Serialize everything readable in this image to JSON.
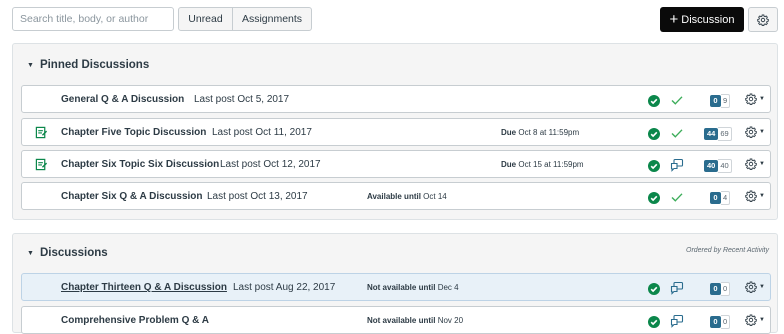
{
  "toolbar": {
    "search_placeholder": "Search title, body, or author",
    "unread_label": "Unread",
    "assignments_label": "Assignments",
    "add_discussion_label": "Discussion",
    "add_discussion_icon": "plus-icon",
    "settings_icon": "gear-icon"
  },
  "pinned": {
    "title": "Pinned Discussions",
    "rows": [
      {
        "title": "General Q & A Discussion",
        "last_post": "Last post Oct 5, 2017",
        "due": "",
        "availability": "",
        "unread": "0",
        "total": "9",
        "state_icon": "checkmark-icon",
        "assignment": false
      },
      {
        "title": "Chapter Five Topic Discussion",
        "last_post": "Last post Oct 11, 2017",
        "due_label": "Due",
        "due": "Oct 8 at 11:59pm",
        "availability": "",
        "unread": "44",
        "total": "69",
        "state_icon": "checkmark-icon",
        "assignment": true
      },
      {
        "title": "Chapter Six Topic Six Discussion",
        "last_post": "Last post Oct 12, 2017",
        "due_label": "Due",
        "due": "Oct 15 at 11:59pm",
        "availability": "",
        "unread": "40",
        "total": "40",
        "state_icon": "reply-icon",
        "assignment": true
      },
      {
        "title": "Chapter Six Q & A Discussion",
        "last_post": "Last post Oct 13, 2017",
        "due": "",
        "availability_label": "Available until",
        "availability": "Oct 14",
        "unread": "0",
        "total": "4",
        "state_icon": "checkmark-icon",
        "assignment": false
      }
    ]
  },
  "discussions": {
    "title": "Discussions",
    "ordered_by": "Ordered by Recent Activity",
    "rows": [
      {
        "title": "Chapter Thirteen Q & A Discussion",
        "last_post": "Last post Aug 22, 2017",
        "availability_label": "Not available until",
        "availability": "Dec 4",
        "unread": "0",
        "total": "0",
        "state_icon": "reply-icon",
        "highlighted": true
      },
      {
        "title": "Comprehensive Problem Q & A",
        "last_post": "",
        "availability_label": "Not available until",
        "availability": "Nov 20",
        "unread": "0",
        "total": "0",
        "state_icon": "reply-icon",
        "highlighted": false
      }
    ]
  },
  "colors": {
    "published_green": "#0b874b",
    "unread_badge": "#2a6c8e",
    "check_green": "#3cad5a",
    "primary_button": "#0a0a0a"
  }
}
